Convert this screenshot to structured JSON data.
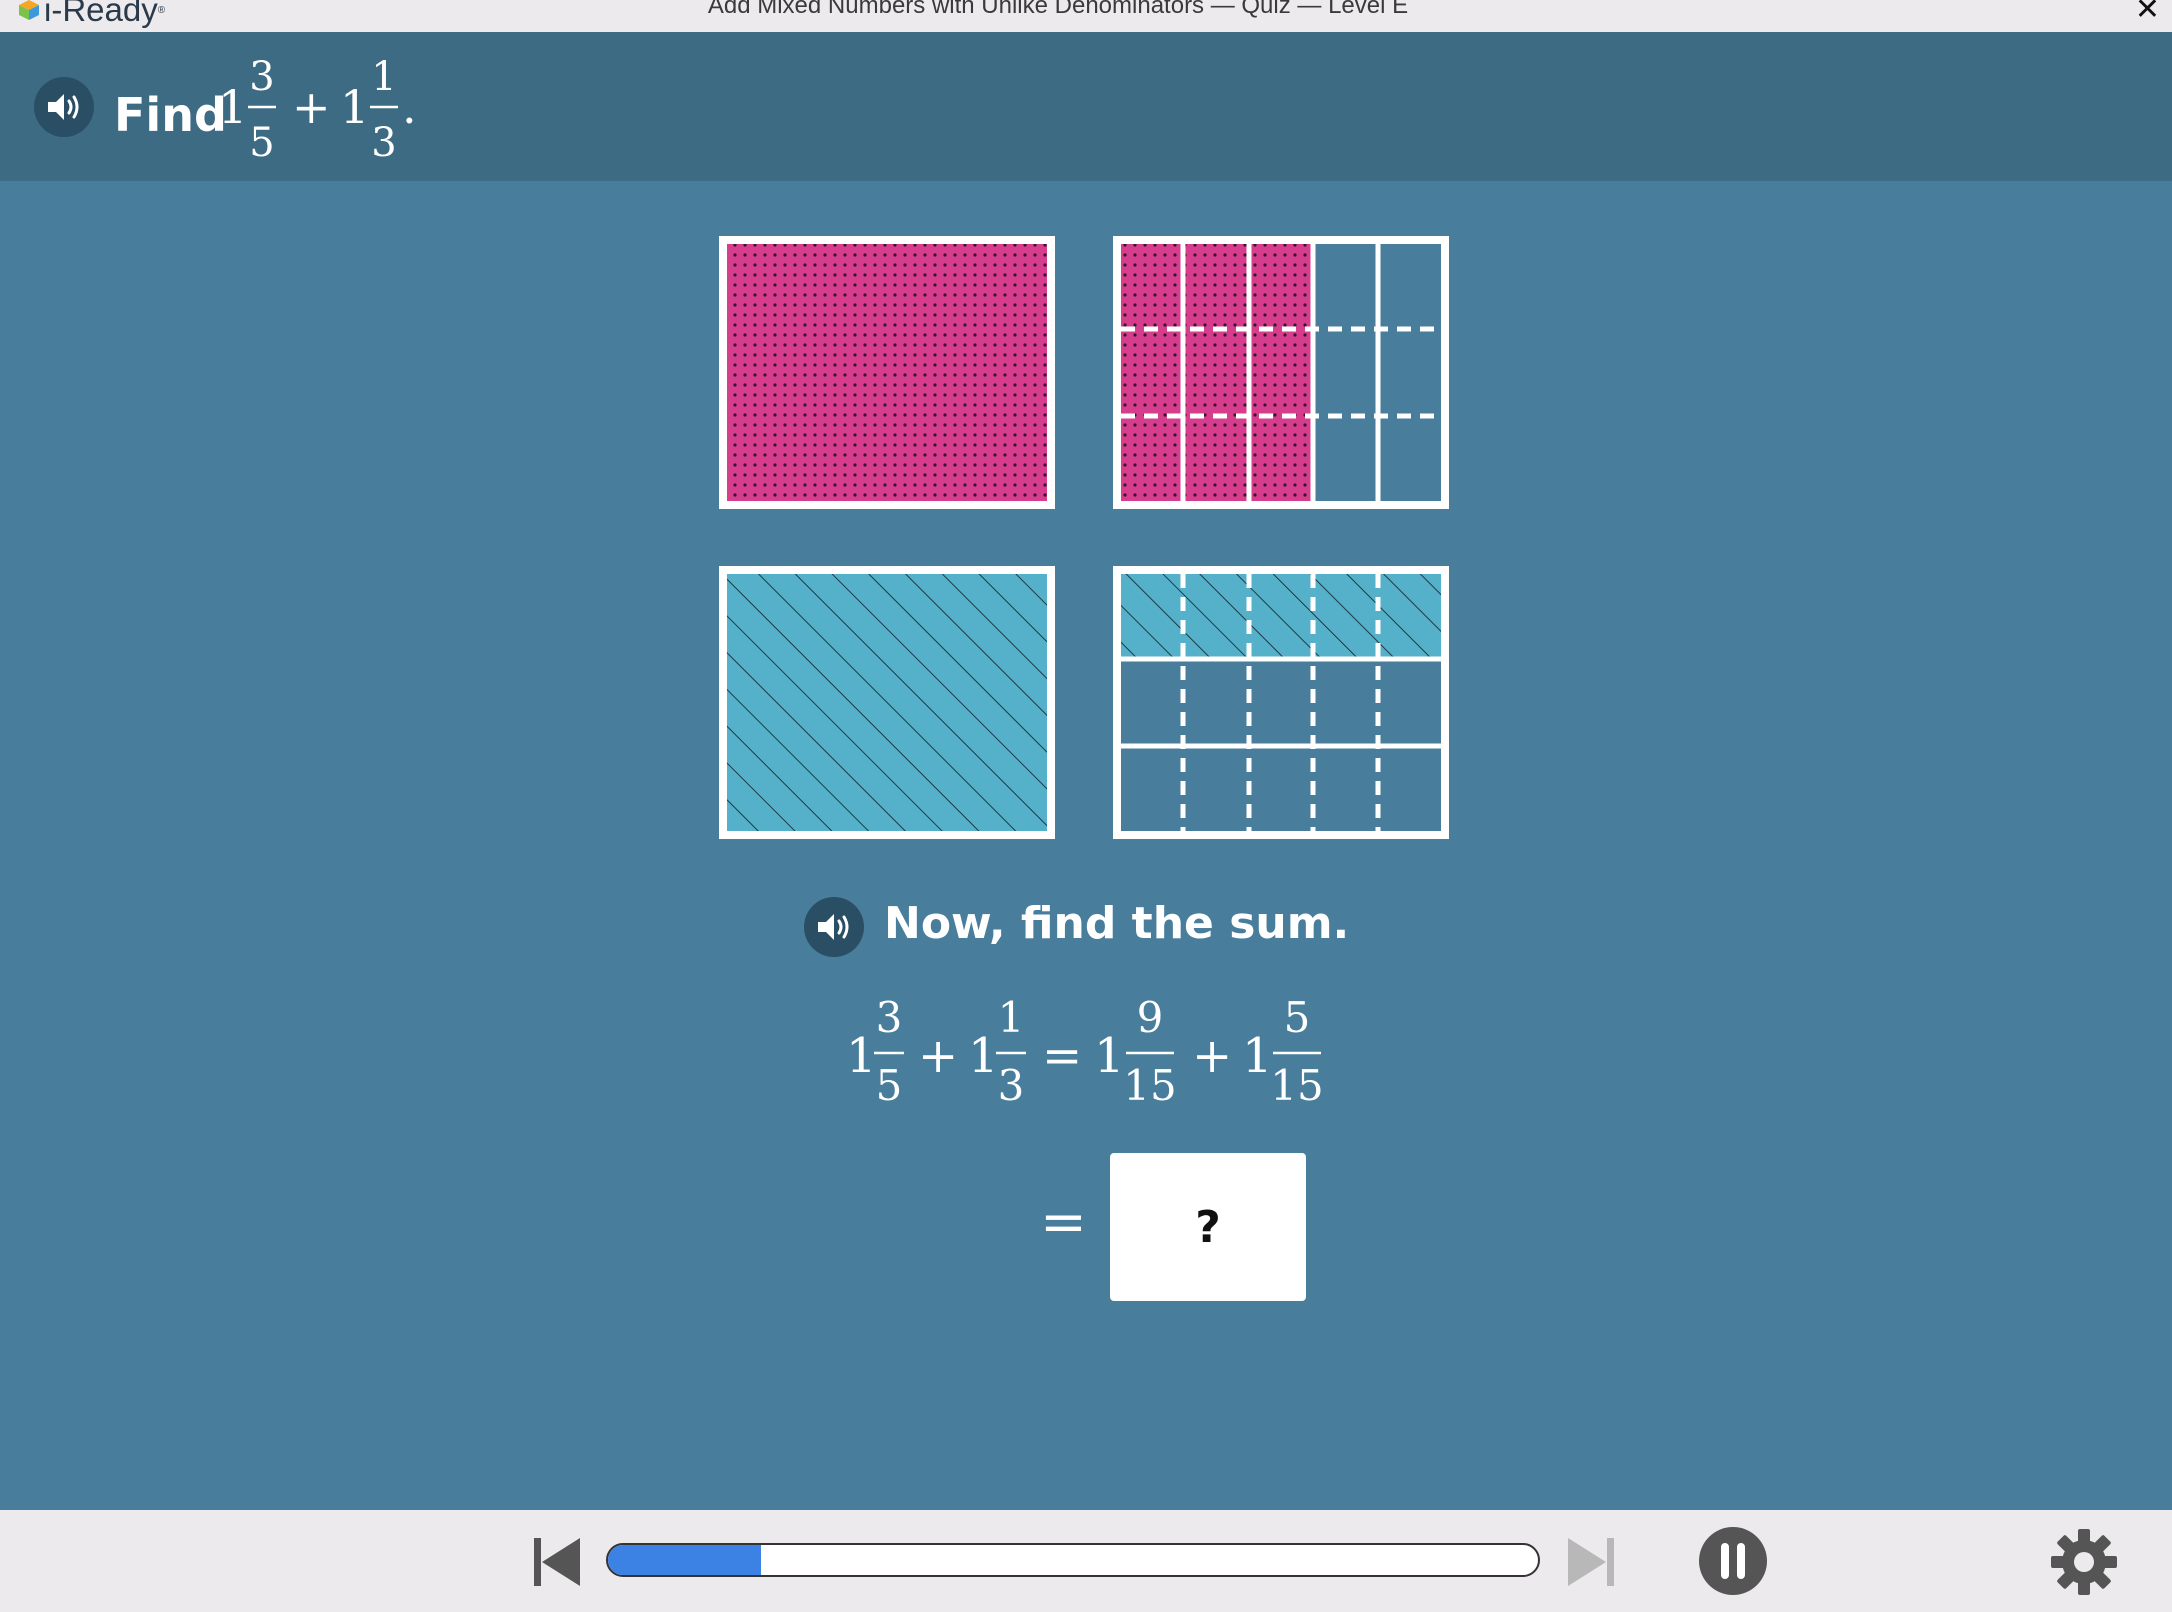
{
  "window": {
    "logo_text": "i-Ready",
    "logo_mark": "®",
    "title": "Add Mixed Numbers with Unlike Denominators — Quiz — Level E",
    "close_glyph": "✕"
  },
  "question": {
    "prefix": "Find",
    "expression": {
      "a_whole": "1",
      "a_num": "3",
      "a_den": "5",
      "op": "+",
      "b_whole": "1",
      "b_num": "1",
      "b_den": "3",
      "end": "."
    }
  },
  "models": {
    "fill_colors": {
      "first_addend": "#d63d8c",
      "second_addend": "#55b1c9"
    },
    "fifths_shaded": 3,
    "thirds_shaded": 1
  },
  "prompt": {
    "text": "Now, find the sum."
  },
  "equation": {
    "lhs": {
      "a_whole": "1",
      "a_num": "3",
      "a_den": "5",
      "op": "+",
      "b_whole": "1",
      "b_num": "1",
      "b_den": "3"
    },
    "eq": "=",
    "rhs": {
      "a_whole": "1",
      "a_num": "9",
      "a_den": "15",
      "op": "+",
      "b_whole": "1",
      "b_num": "5",
      "b_den": "15"
    }
  },
  "answer": {
    "equals": "=",
    "placeholder": "?"
  },
  "player": {
    "progress_fraction": 0.165,
    "icons": [
      "skip-back-icon",
      "skip-forward-icon",
      "pause-icon",
      "gear-icon"
    ],
    "accent": "#3b82e4"
  }
}
